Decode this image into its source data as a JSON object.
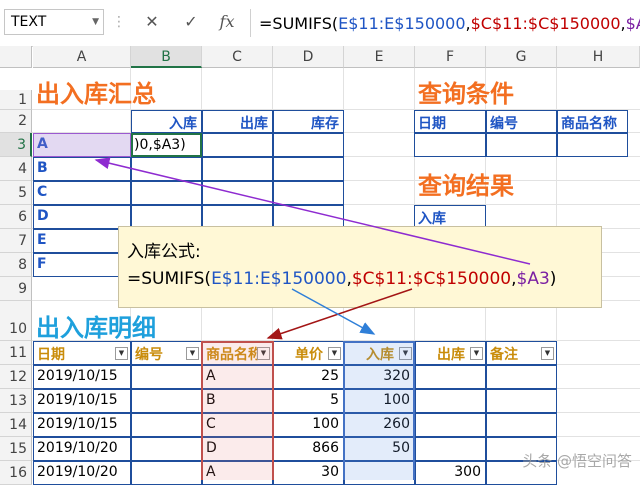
{
  "formula_bar": {
    "name_box": "TEXT",
    "cancel_icon": "x-icon",
    "enter_icon": "check-icon",
    "function_icon": "fx-icon",
    "fx_label": "fx",
    "formula_parts": [
      "=SUMIFS(",
      "E$11:E$150000",
      ",",
      "$C$11:$C$150000",
      ",",
      "$A3",
      ")"
    ]
  },
  "columns": [
    "A",
    "B",
    "C",
    "D",
    "E",
    "F",
    "G",
    "H"
  ],
  "rows": [
    "1",
    "2",
    "3",
    "4",
    "5",
    "6",
    "7",
    "8",
    "9",
    "10",
    "11",
    "12",
    "13",
    "14",
    "15",
    "16"
  ],
  "summary": {
    "title": "出入库汇总",
    "headers": [
      "入库",
      "出库",
      "库存"
    ],
    "items": [
      "A",
      "B",
      "C",
      "D",
      "E",
      "F"
    ],
    "editing_text": ")0,$A3)"
  },
  "query": {
    "title": "查询条件",
    "headers": [
      "日期",
      "编号",
      "商品名称"
    ],
    "result_title": "查询结果",
    "result_label": "入库"
  },
  "popup": {
    "line1": "入库公式:",
    "formula_parts": [
      "=SUMIFS(",
      "E$11:E$150000",
      ",",
      "$C$11:$C$150000",
      ",",
      "$A3",
      ")"
    ]
  },
  "detail": {
    "title": "出入库明细",
    "headers": [
      "日期",
      "编号",
      "商品名称",
      "单价",
      "入库",
      "出库",
      "备注"
    ],
    "rows": [
      {
        "date": "2019/10/15",
        "code": "",
        "name": "A",
        "price": "25",
        "in": "320",
        "out": "",
        "note": ""
      },
      {
        "date": "2019/10/15",
        "code": "",
        "name": "B",
        "price": "5",
        "in": "100",
        "out": "",
        "note": ""
      },
      {
        "date": "2019/10/15",
        "code": "",
        "name": "C",
        "price": "100",
        "in": "260",
        "out": "",
        "note": ""
      },
      {
        "date": "2019/10/20",
        "code": "",
        "name": "D",
        "price": "866",
        "in": "50",
        "out": "",
        "note": ""
      },
      {
        "date": "2019/10/20",
        "code": "",
        "name": "A",
        "price": "30",
        "in": "",
        "out": "300",
        "note": ""
      }
    ]
  },
  "watermark": "头条 @悟空问答",
  "colors": {
    "orange": "#f36f21",
    "cyan": "#1ea0dc",
    "blue": "#1f55c4",
    "red": "#c00000",
    "purple": "#7b1fa2",
    "header_gold": "#c98c0a"
  }
}
